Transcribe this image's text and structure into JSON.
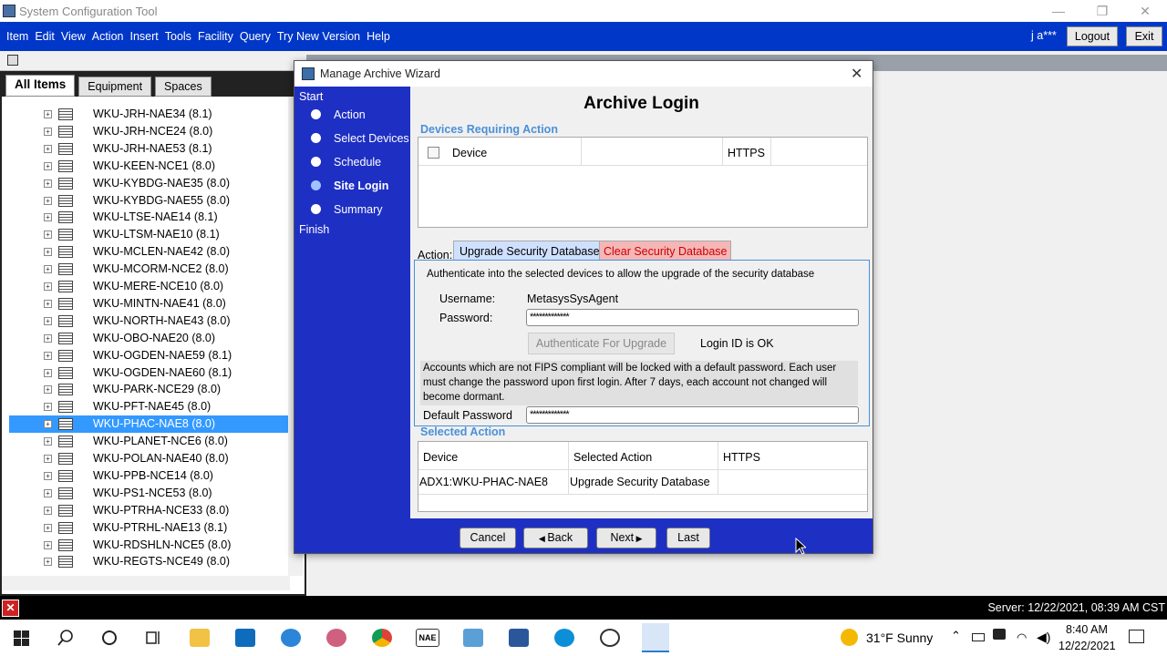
{
  "window": {
    "title": "System Configuration Tool",
    "minimize": "—",
    "maximize": "❐",
    "close": "✕"
  },
  "menubar": {
    "items": [
      "Item",
      "Edit",
      "View",
      "Action",
      "Insert",
      "Tools",
      "Facility",
      "Query",
      "Try New Version",
      "Help"
    ],
    "user": "j a***",
    "logout": "Logout",
    "exit": "Exit"
  },
  "tabs": [
    "All Items",
    "Equipment",
    "Spaces"
  ],
  "tree": {
    "items": [
      "WKU-JRH-NAE34 (8.1)",
      "WKU-JRH-NCE24 (8.0)",
      "WKU-JRH-NAE53 (8.1)",
      "WKU-KEEN-NCE1 (8.0)",
      "WKU-KYBDG-NAE35 (8.0)",
      "WKU-KYBDG-NAE55 (8.0)",
      "WKU-LTSE-NAE14 (8.1)",
      "WKU-LTSM-NAE10 (8.1)",
      "WKU-MCLEN-NAE42 (8.0)",
      "WKU-MCORM-NCE2 (8.0)",
      "WKU-MERE-NCE10 (8.0)",
      "WKU-MINTN-NAE41 (8.0)",
      "WKU-NORTH-NAE43 (8.0)",
      "WKU-OBO-NAE20 (8.0)",
      "WKU-OGDEN-NAE59 (8.1)",
      "WKU-OGDEN-NAE60 (8.1)",
      "WKU-PARK-NCE29 (8.0)",
      "WKU-PFT-NAE45 (8.0)",
      "WKU-PHAC-NAE8 (8.0)",
      "WKU-PLANET-NCE6 (8.0)",
      "WKU-POLAN-NAE40 (8.0)",
      "WKU-PPB-NCE14 (8.0)",
      "WKU-PS1-NCE53 (8.0)",
      "WKU-PTRHA-NCE33 (8.0)",
      "WKU-PTRHL-NAE13 (8.1)",
      "WKU-RDSHLN-NCE5 (8.0)",
      "WKU-REGTS-NCE49 (8.0)"
    ],
    "selected_index": 18
  },
  "dialog": {
    "title": "Manage Archive Wizard",
    "close": "✕",
    "steps": {
      "start": "Start",
      "action": "Action",
      "select_devices": "Select Devices",
      "schedule": "Schedule",
      "site_login": "Site Login",
      "summary": "Summary",
      "finish": "Finish"
    },
    "heading": "Archive Login",
    "devices_group": "Devices Requiring Action",
    "devices_cols": {
      "device": "Device",
      "https": "HTTPS"
    },
    "action_label": "Action:",
    "action_tabs": {
      "upgrade": "Upgrade Security Database",
      "clear": "Clear Security Database"
    },
    "auth_text": "Authenticate into the selected devices to allow the upgrade of the security database",
    "username_label": "Username:",
    "username_value": "MetasysSysAgent",
    "password_label": "Password:",
    "password_value": "*************",
    "auth_button": "Authenticate For Upgrade",
    "login_status": "Login ID is OK",
    "fips_note": "Accounts which are not FIPS compliant will be locked with a default password. Each user must change the password upon first login. After 7 days, each account not changed will become dormant.",
    "default_pw_label": "Default Password",
    "default_pw_value": "*************",
    "selected_group": "Selected Action",
    "selected_cols": {
      "device": "Device",
      "action": "Selected Action",
      "https": "HTTPS"
    },
    "selected_row": {
      "device": "ADX1:WKU-PHAC-NAE8",
      "action": "Upgrade Security Database",
      "https": ""
    },
    "buttons": {
      "cancel": "Cancel",
      "back": "Back",
      "next": "Next",
      "last": "Last"
    }
  },
  "statusbar": {
    "server": "Server: 12/22/2021, 08:39 AM CST"
  },
  "taskbar": {
    "weather": "31°F  Sunny",
    "time": "8:40 AM",
    "date": "12/22/2021",
    "nae_label": "NAE"
  },
  "colors": {
    "menubar": "#0037c8",
    "wizard_blue": "#1e2fc4",
    "selection": "#3399ff",
    "clear_tab": "#f4b6b6",
    "upgrade_tab": "#cfe0ff"
  }
}
